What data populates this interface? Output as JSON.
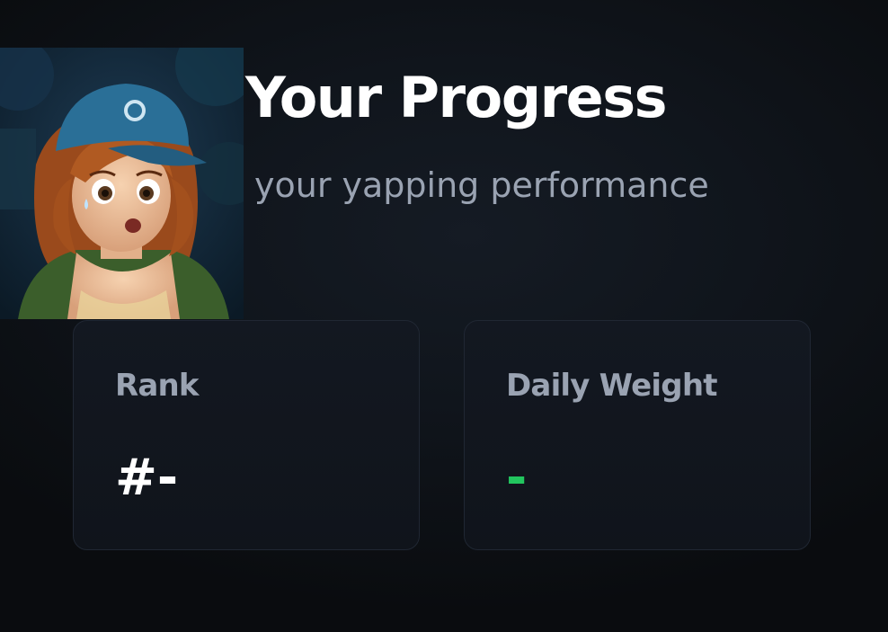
{
  "header": {
    "title": "Your Progress",
    "subtitle": "your yapping performance"
  },
  "stats": {
    "rank": {
      "label": "Rank",
      "value": "#-"
    },
    "daily_weight": {
      "label": "Daily Weight",
      "value": "-"
    }
  },
  "colors": {
    "background": "#0b0d10",
    "card_background": "#131821",
    "label_gray": "#9aa3b2",
    "accent_green": "#22c55e"
  }
}
